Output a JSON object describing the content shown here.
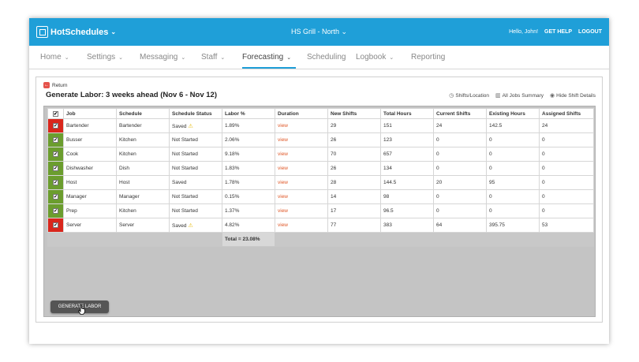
{
  "topbar": {
    "brand": "HotSchedules",
    "location": "HS Grill - North",
    "greeting": "Hello, John!",
    "get_help": "GET HELP",
    "logout": "LOGOUT"
  },
  "nav": {
    "items": [
      {
        "label": "Home"
      },
      {
        "label": "Settings"
      },
      {
        "label": "Messaging"
      },
      {
        "label": "Staff"
      },
      {
        "label": "Forecasting"
      },
      {
        "label": "Scheduling"
      },
      {
        "label": "Logbook"
      },
      {
        "label": "Reporting"
      }
    ],
    "active": "Forecasting"
  },
  "page": {
    "return_label": "Return",
    "title": "Generate Labor: 3 weeks ahead (Nov 6 - Nov 12)",
    "tools": {
      "shifts_location": "Shifts/Location",
      "all_jobs_summary": "All Jobs Summary",
      "hide_shift_details": "Hide Shift Details"
    }
  },
  "table": {
    "columns": [
      "Job",
      "Schedule",
      "Schedule Status",
      "Labor %",
      "Duration",
      "New Shifts",
      "Total Hours",
      "Current Shifts",
      "Existing Hours",
      "Assigned Shifts"
    ],
    "rows": [
      {
        "flag": "red",
        "job": "Bartender",
        "schedule": "Bartender",
        "status": "Saved",
        "warn": true,
        "labor": "1.89%",
        "duration": "view",
        "new_shifts": "29",
        "total_hours": "151",
        "current_shifts": "24",
        "existing_hours": "142.5",
        "assigned_shifts": "24"
      },
      {
        "flag": "green",
        "job": "Busser",
        "schedule": "Kitchen",
        "status": "Not Started",
        "warn": false,
        "labor": "2.06%",
        "duration": "view",
        "new_shifts": "26",
        "total_hours": "123",
        "current_shifts": "0",
        "existing_hours": "0",
        "assigned_shifts": "0"
      },
      {
        "flag": "green",
        "job": "Cook",
        "schedule": "Kitchen",
        "status": "Not Started",
        "warn": false,
        "labor": "9.18%",
        "duration": "view",
        "new_shifts": "70",
        "total_hours": "657",
        "current_shifts": "0",
        "existing_hours": "0",
        "assigned_shifts": "0"
      },
      {
        "flag": "green",
        "job": "Dishwasher",
        "schedule": "Dish",
        "status": "Not Started",
        "warn": false,
        "labor": "1.83%",
        "duration": "view",
        "new_shifts": "26",
        "total_hours": "134",
        "current_shifts": "0",
        "existing_hours": "0",
        "assigned_shifts": "0"
      },
      {
        "flag": "green",
        "job": "Host",
        "schedule": "Host",
        "status": "Saved",
        "warn": false,
        "labor": "1.78%",
        "duration": "view",
        "new_shifts": "28",
        "total_hours": "144.5",
        "current_shifts": "20",
        "existing_hours": "95",
        "assigned_shifts": "0"
      },
      {
        "flag": "green",
        "job": "Manager",
        "schedule": "Manager",
        "status": "Not Started",
        "warn": false,
        "labor": "0.15%",
        "duration": "view",
        "new_shifts": "14",
        "total_hours": "98",
        "current_shifts": "0",
        "existing_hours": "0",
        "assigned_shifts": "0"
      },
      {
        "flag": "green",
        "job": "Prep",
        "schedule": "Kitchen",
        "status": "Not Started",
        "warn": false,
        "labor": "1.37%",
        "duration": "view",
        "new_shifts": "17",
        "total_hours": "96.5",
        "current_shifts": "0",
        "existing_hours": "0",
        "assigned_shifts": "0"
      },
      {
        "flag": "red",
        "job": "Server",
        "schedule": "Server",
        "status": "Saved",
        "warn": true,
        "labor": "4.82%",
        "duration": "view",
        "new_shifts": "77",
        "total_hours": "383",
        "current_shifts": "64",
        "existing_hours": "395.75",
        "assigned_shifts": "53"
      }
    ],
    "total": "Total = 23.08%"
  },
  "actions": {
    "generate_labor": "GENERATE LABOR"
  },
  "colors": {
    "brand_blue": "#1f9fd8",
    "flag_red": "#d9261c",
    "flag_green": "#6b9d2e",
    "link_orange": "#e05a2a"
  }
}
